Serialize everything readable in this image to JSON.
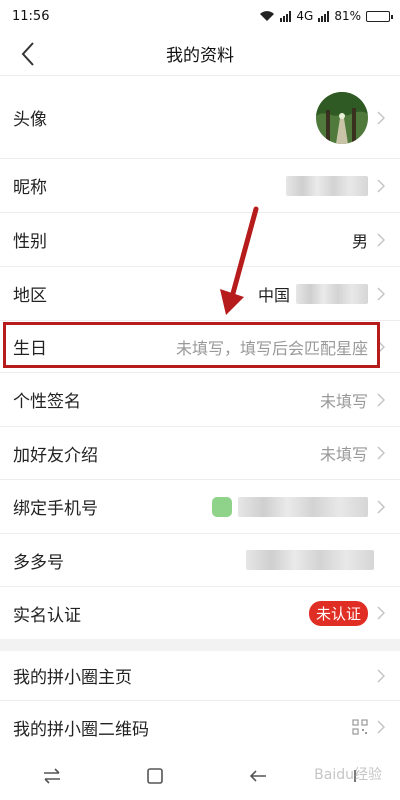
{
  "status_bar": {
    "time": "11:56",
    "network": "4G",
    "battery": "81%",
    "battery_level": 0.81,
    "icons": [
      "wifi-icon",
      "signal-icon",
      "battery-icon"
    ]
  },
  "header": {
    "title": "我的资料",
    "back_icon": "chevron-left-icon"
  },
  "rows": {
    "avatar": {
      "label": "头像"
    },
    "nickname": {
      "label": "昵称"
    },
    "gender": {
      "label": "性别",
      "value": "男"
    },
    "region": {
      "label": "地区",
      "value": "中国"
    },
    "birthday": {
      "label": "生日",
      "value": "未填写，填写后会匹配星座"
    },
    "signature": {
      "label": "个性签名",
      "value": "未填写"
    },
    "intro": {
      "label": "加好友介绍",
      "value": "未填写"
    },
    "phone": {
      "label": "绑定手机号"
    },
    "duoduo": {
      "label": "多多号"
    },
    "realname": {
      "label": "实名认证",
      "value": "未认证"
    },
    "circle_home": {
      "label": "我的拼小圈主页"
    },
    "circle_qr": {
      "label": "我的拼小圈二维码"
    }
  },
  "colors": {
    "accent_red": "#e02e24",
    "highlight_red": "#b71c1c"
  },
  "bottom_nav": {
    "icons": [
      "switch-arrows-icon",
      "home-square-icon",
      "back-arrow-icon",
      "menu-icon"
    ]
  },
  "watermark": "Baidu经验"
}
